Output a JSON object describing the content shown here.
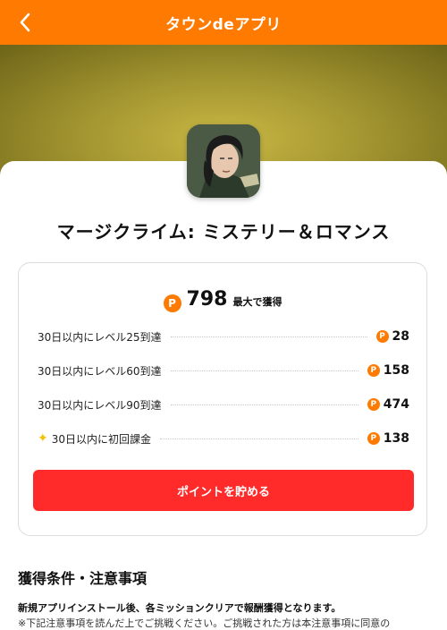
{
  "header": {
    "title": "タウンdeアプリ",
    "back_icon": "chevron-left-icon",
    "bg_color": "#ff7a00"
  },
  "app": {
    "name": "マージクライム: ミステリー＆ロマンス",
    "icon": "app-icon-character-portrait"
  },
  "reward": {
    "coin_symbol": "P",
    "total": "798",
    "total_suffix": "最大で獲得",
    "missions": [
      {
        "label": "30日以内にレベル25到達",
        "points": "28"
      },
      {
        "label": "30日以内にレベル60到達",
        "points": "158"
      },
      {
        "label": "30日以内にレベル90到達",
        "points": "474"
      },
      {
        "label": "30日以内に初回課金",
        "points": "138",
        "icon": "sparkle-icon"
      }
    ],
    "cta_label": "ポイントを貯める",
    "cta_color": "#ff2a2a"
  },
  "conditions": {
    "title": "獲得条件・注意事項",
    "lead": "新規アプリインストール後、各ミッションクリアで報酬獲得となります。",
    "note": "※下記注意事項を読んだ上でご挑戦ください。ご挑戦された方は本注意事項に同意の"
  }
}
